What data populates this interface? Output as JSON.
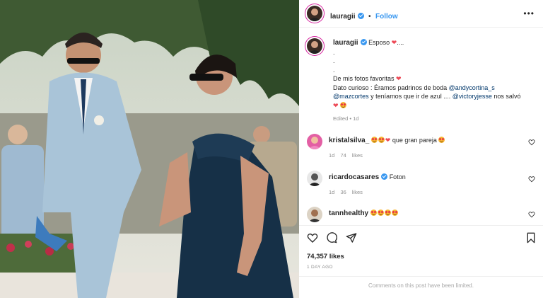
{
  "post": {
    "username": "lauragii",
    "follow_label": "Follow",
    "more_label": "•••"
  },
  "caption": {
    "username": "lauragii",
    "first_line": "Esposo",
    "ellipsis": "....",
    "dot1": ".",
    "dot2": ".",
    "dot3": ".",
    "line_favorites": "De mis fotos favoritas",
    "line_fact_prefix": "Dato curioso : Éramos padrinos de boda",
    "mention1": "@andycortina_s",
    "mention2": "@mazcortes",
    "line_blue": "y teníamos que ir de azul ....",
    "mention3": "@victoryjesse",
    "line_saved": "nos salvó",
    "edited": "Edited",
    "edited_time": "1d"
  },
  "comments": [
    {
      "username": "kristalsilva_",
      "text": "que gran pareja",
      "time": "1d",
      "likes": "74 likes"
    },
    {
      "username": "ricardocasares",
      "text": "Foton",
      "time": "1d",
      "likes": "36 likes"
    },
    {
      "username": "tannhealthy",
      "text": "",
      "time": "",
      "likes": ""
    }
  ],
  "actions": {
    "likes": "74,357 likes",
    "time_ago": "1 DAY AGO",
    "comments_limited": "Comments on this post have been limited."
  },
  "colors": {
    "link": "#00376b",
    "accent": "#3897f0",
    "heart": "#ed4956",
    "muted": "#8e8e8e"
  }
}
